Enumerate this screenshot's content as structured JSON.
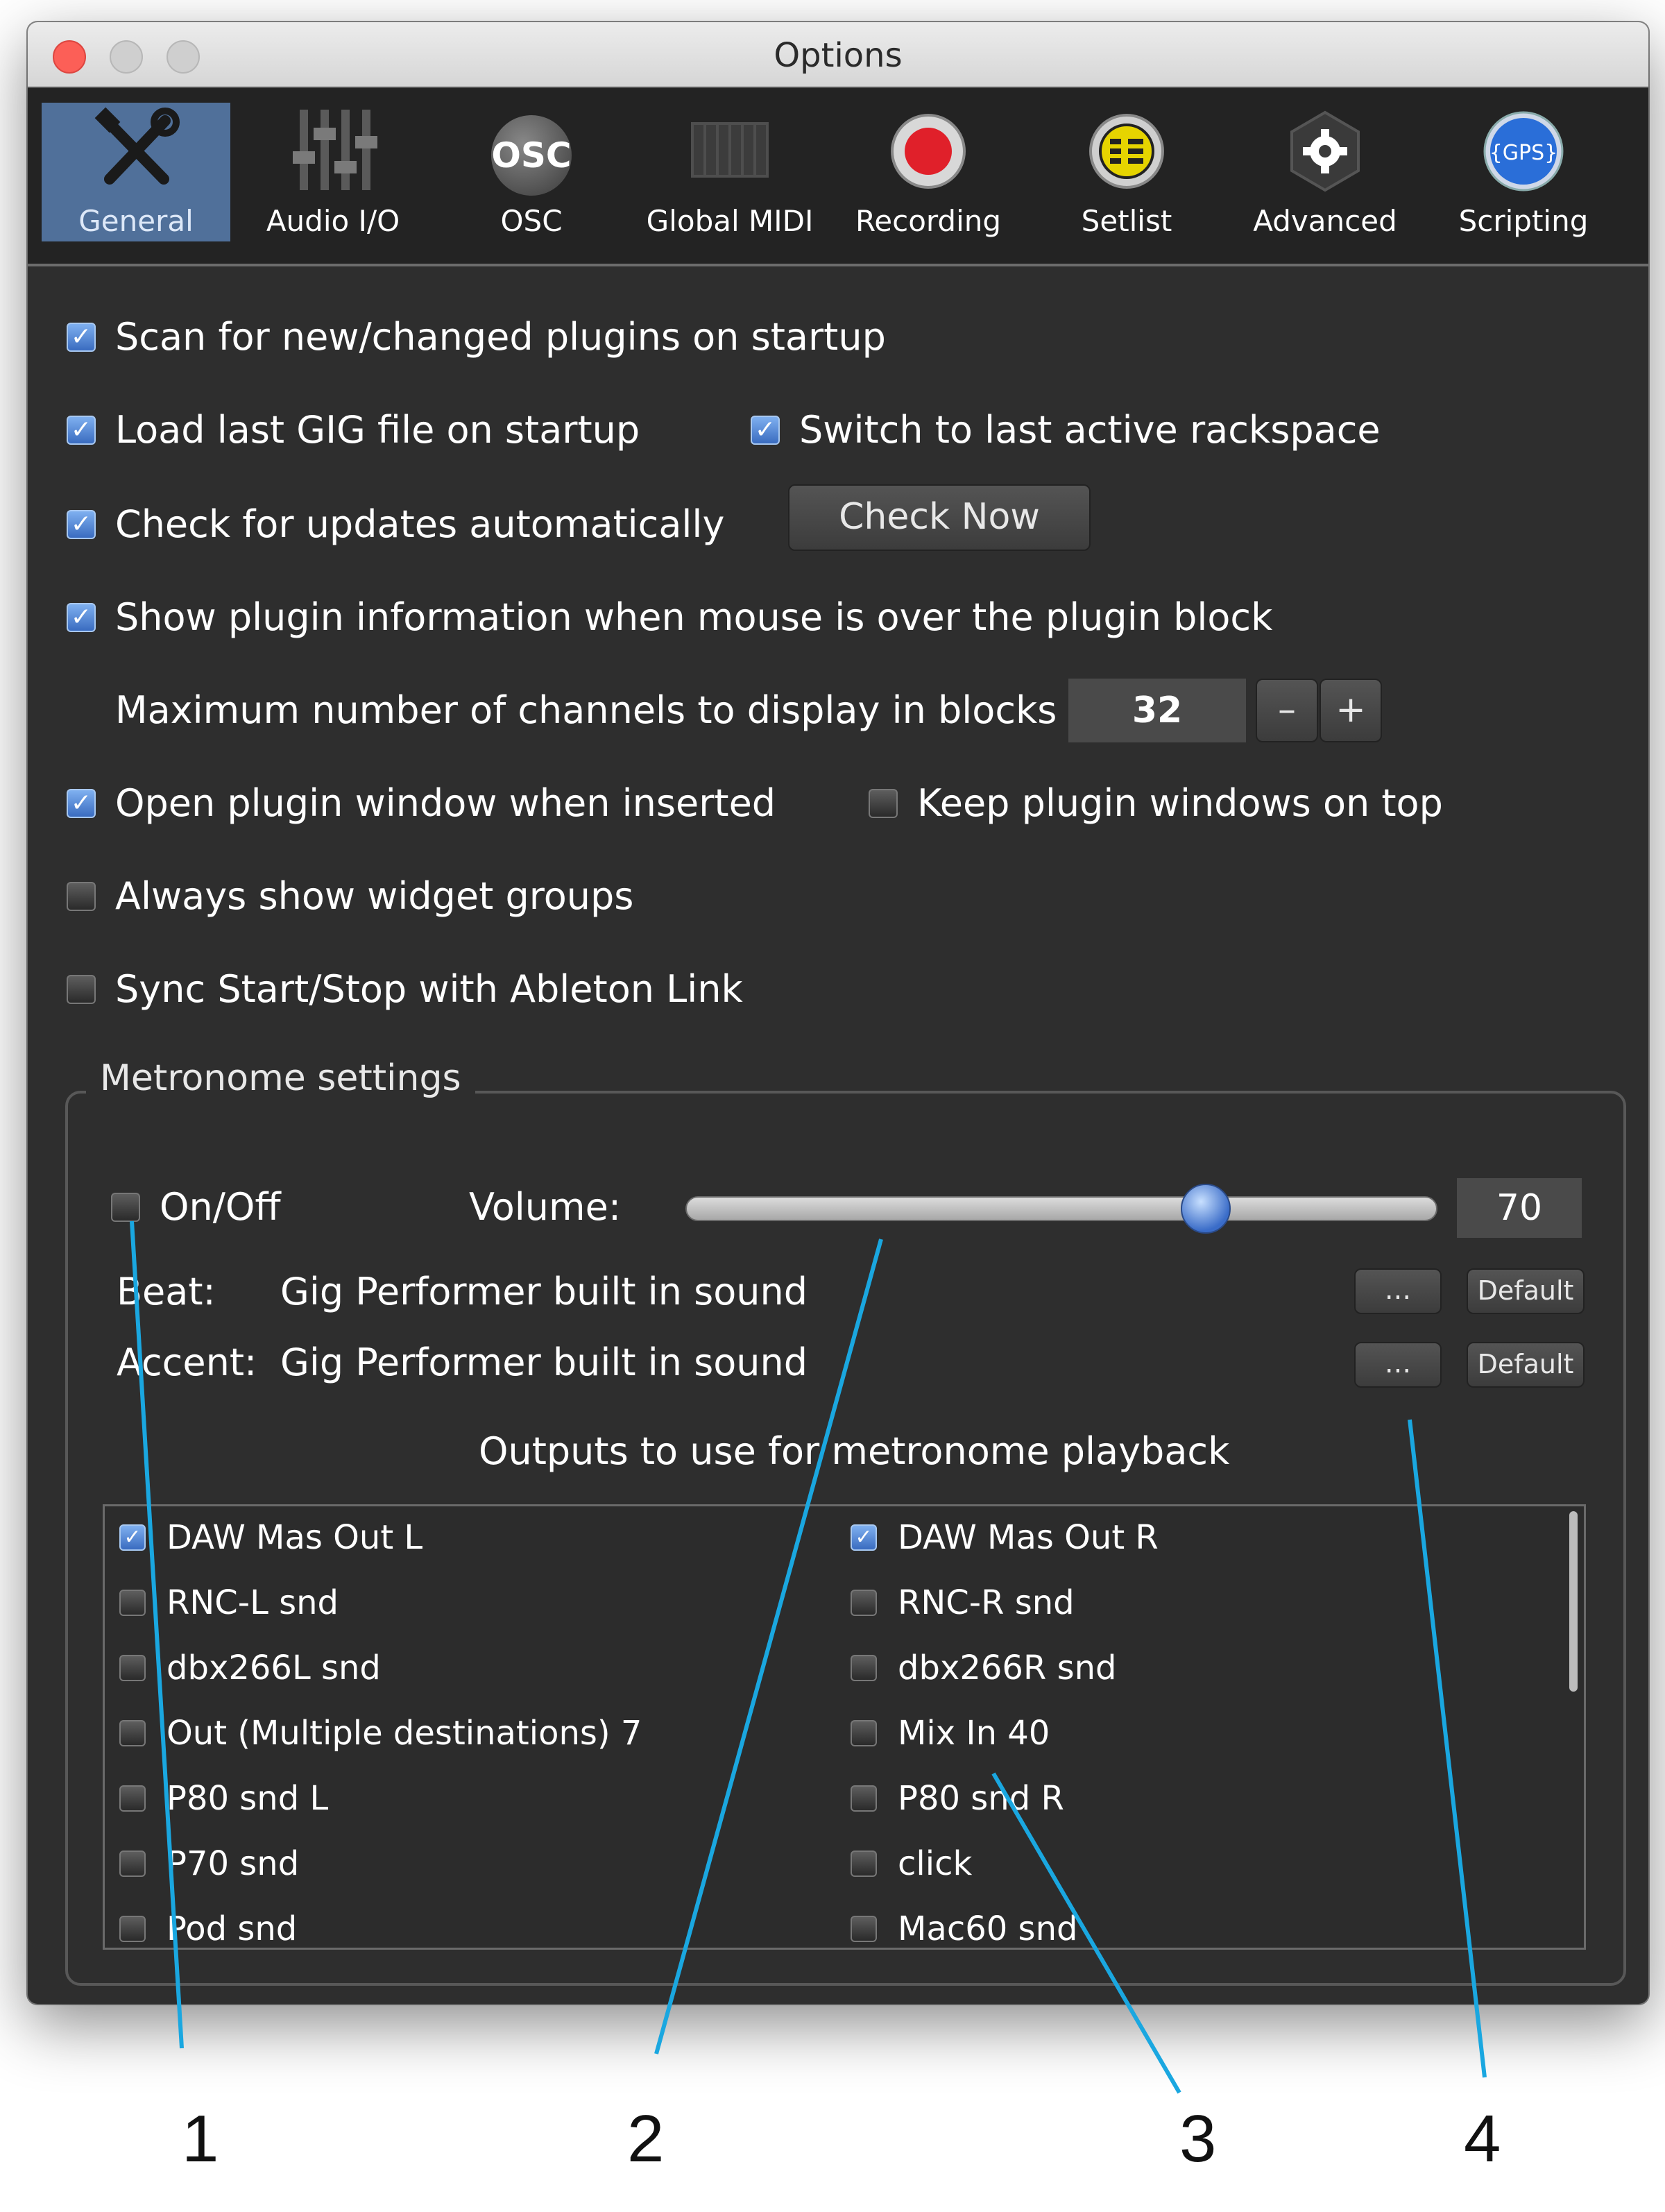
{
  "window": {
    "title": "Options"
  },
  "toolbar": {
    "tabs": [
      {
        "label": "General",
        "icon": "tools-icon",
        "active": true
      },
      {
        "label": "Audio I/O",
        "icon": "mixer-faders-icon",
        "active": false
      },
      {
        "label": "OSC",
        "icon": "osc-icon",
        "icon_text": "OSC",
        "active": false
      },
      {
        "label": "Global MIDI",
        "icon": "piano-keyboard-icon",
        "active": false
      },
      {
        "label": "Recording",
        "icon": "record-icon",
        "active": false
      },
      {
        "label": "Setlist",
        "icon": "setlist-icon",
        "active": false
      },
      {
        "label": "Advanced",
        "icon": "gear-icon",
        "active": false
      },
      {
        "label": "Scripting",
        "icon": "gps-script-icon",
        "icon_text": "{GPS}",
        "active": false
      }
    ]
  },
  "general": {
    "scan_plugins": {
      "label": "Scan for new/changed plugins on startup",
      "checked": true
    },
    "load_last_gig": {
      "label": "Load last GIG file on startup",
      "checked": true
    },
    "switch_last_rackspace": {
      "label": "Switch to last active rackspace",
      "checked": true
    },
    "check_updates": {
      "label": "Check for updates automatically",
      "checked": true
    },
    "check_now_label": "Check Now",
    "show_plugin_info": {
      "label": "Show plugin information when mouse is over the plugin block",
      "checked": true
    },
    "max_channels_label": "Maximum number of channels to display in blocks",
    "max_channels_value": "32",
    "minus_label": "–",
    "plus_label": "+",
    "open_plugin_window": {
      "label": "Open plugin window when inserted",
      "checked": true
    },
    "keep_on_top": {
      "label": "Keep plugin windows on top",
      "checked": false
    },
    "always_show_widgets": {
      "label": "Always show widget groups",
      "checked": false
    },
    "sync_ableton": {
      "label": "Sync Start/Stop with Ableton Link",
      "checked": false
    }
  },
  "metronome": {
    "group_title": "Metronome settings",
    "on_off": {
      "label": "On/Off",
      "checked": false
    },
    "volume_label": "Volume:",
    "volume_value": "70",
    "volume_level_percent": 70,
    "beat_label": "Beat:",
    "beat_sound": "Gig Performer built in sound",
    "accent_label": "Accent:",
    "accent_sound": "Gig Performer built in sound",
    "browse_label": "...",
    "default_label": "Default",
    "outputs_title": "Outputs to use for metronome playback",
    "outputs_left": [
      {
        "label": "DAW Mas Out L",
        "checked": true
      },
      {
        "label": "RNC-L snd",
        "checked": false
      },
      {
        "label": "dbx266L snd",
        "checked": false
      },
      {
        "label": "Out (Multiple destinations) 7",
        "checked": false
      },
      {
        "label": "P80 snd L",
        "checked": false
      },
      {
        "label": "P70 snd",
        "checked": false
      },
      {
        "label": "Pod snd",
        "checked": false
      }
    ],
    "outputs_right": [
      {
        "label": "DAW Mas Out R",
        "checked": true
      },
      {
        "label": "RNC-R snd",
        "checked": false
      },
      {
        "label": "dbx266R snd",
        "checked": false
      },
      {
        "label": "Mix In 40",
        "checked": false
      },
      {
        "label": "P80 snd R",
        "checked": false
      },
      {
        "label": "click",
        "checked": false
      },
      {
        "label": "Mac60 snd",
        "checked": false
      }
    ]
  },
  "callouts": [
    "1",
    "2",
    "3",
    "4"
  ],
  "colors": {
    "active_tab": "#50709a",
    "window_bg": "#2e2e2e",
    "toolbar_bg": "#232323",
    "callout_line": "#1aa7e0",
    "record_red": "#e0202a",
    "setlist_yellow": "#e6d400",
    "scripting_blue": "#2a6ed8"
  }
}
